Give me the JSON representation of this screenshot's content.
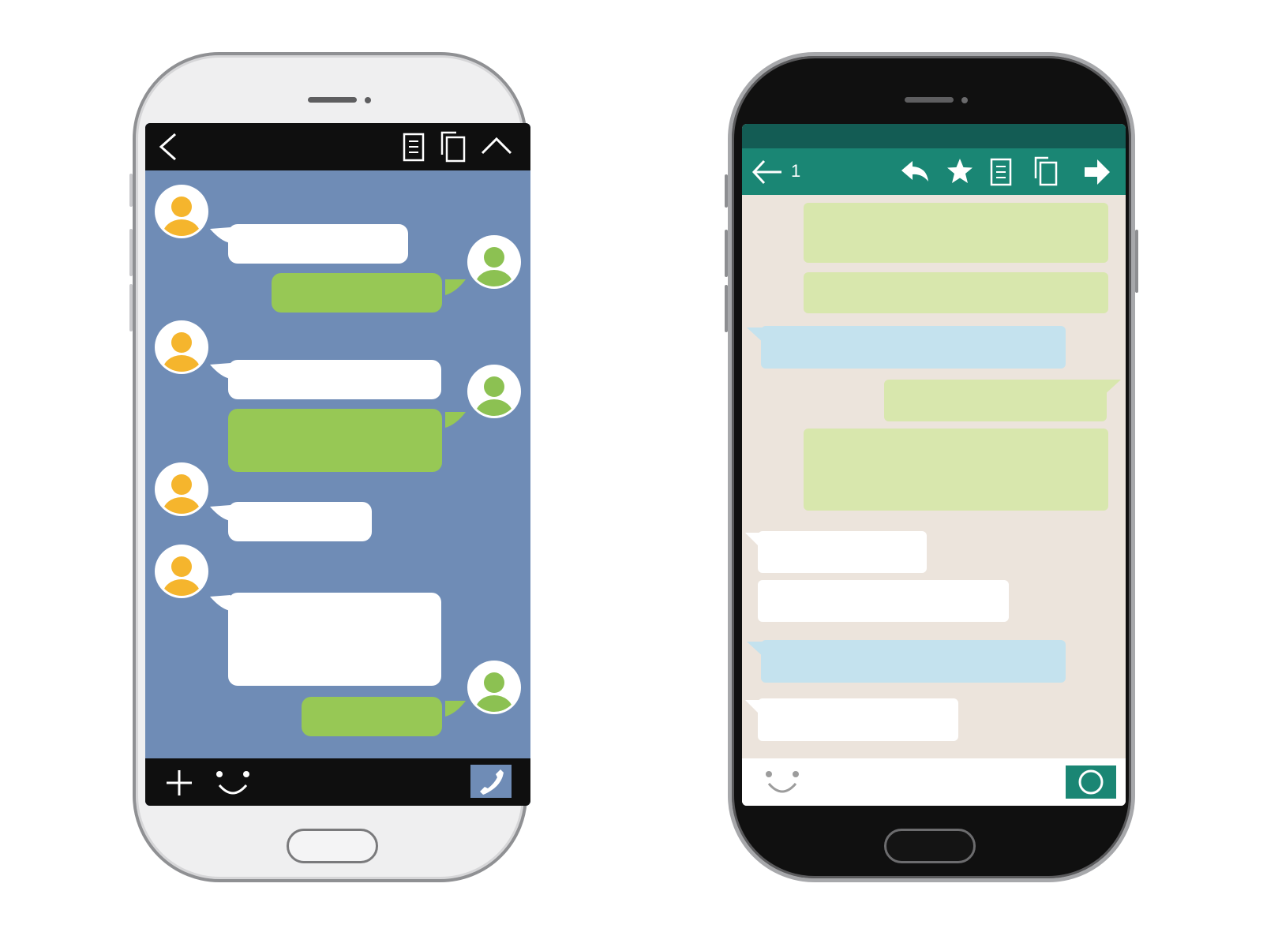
{
  "left_phone": {
    "theme": {
      "body": "#efeff0",
      "bars": "#0f0f0f",
      "chat_background": "#6f8cb6",
      "incoming_bubble": "#ffffff",
      "outgoing_bubble": "#97c855",
      "incoming_avatar": "#f5b52d",
      "outgoing_avatar": "#8cc152"
    },
    "toolbar_icons": [
      "back-chevron-icon",
      "notes-icon",
      "copy-icon",
      "collapse-up-icon"
    ],
    "bottom_icons": [
      "add-icon",
      "emoji-icon",
      "phone-call-icon"
    ]
  },
  "right_phone": {
    "theme": {
      "body": "#101010",
      "status_bar": "#135c54",
      "toolbar": "#1a8674",
      "chat_background": "#ece4dc",
      "sent_bubble": "#d8e7ad",
      "received_bubble": "#ffffff",
      "highlight_bubble": "#c4e2ee",
      "camera_button": "#1a8674"
    },
    "toolbar": {
      "selected_count": "1"
    },
    "toolbar_icons": [
      "back-arrow-icon",
      "reply-icon",
      "star-icon",
      "notes-icon",
      "copy-icon",
      "forward-icon"
    ],
    "bottom_icons": [
      "emoji-icon",
      "camera-button-icon"
    ]
  }
}
